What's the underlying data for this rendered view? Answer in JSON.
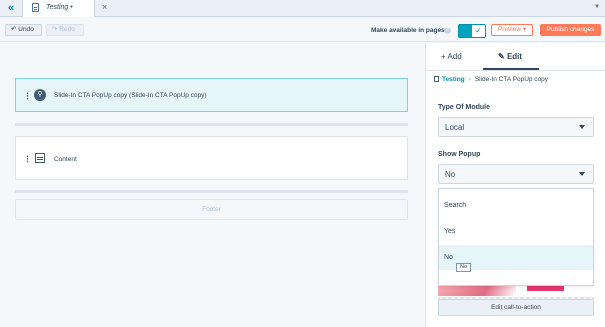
{
  "tabbar": {
    "collapse_icon": "double-chevron-left",
    "tab_title": "Testing",
    "tab_modified": "•",
    "close_icon": "×",
    "menu_caret": "▼"
  },
  "toolbar": {
    "undo_label": "Undo",
    "redo_label": "Redo",
    "available_label": "Make available in pages",
    "available_enabled": true,
    "preview_label": "Preview",
    "publish_label": "Publish changes"
  },
  "canvas": {
    "modules": [
      {
        "label": "Slide-In CTA PopUp copy (Slide-In CTA PopUp copy)",
        "icon": "link-icon",
        "selected": true
      },
      {
        "label": "Content",
        "icon": "content-icon",
        "selected": false
      }
    ],
    "footer_label": "Footer"
  },
  "sidebar": {
    "tabs": [
      {
        "label": "Add"
      },
      {
        "label": "Edit"
      }
    ],
    "active_tab": "Edit",
    "breadcrumb": {
      "parent": "Testing",
      "current": "Slide-In CTA PopUp copy"
    },
    "type_of_module": {
      "label": "Type Of Module",
      "value": "Local"
    },
    "show_popup": {
      "label": "Show Popup",
      "value": "No",
      "options": [
        "Search",
        "Yes",
        "No"
      ],
      "highlighted": "No",
      "tooltip": "No"
    },
    "edit_cta_label": "Edit call-to-action"
  },
  "colors": {
    "accent": "#ff7a59",
    "teal": "#00a4bd",
    "selected_bg": "#e5f5f8",
    "text": "#33475b"
  }
}
